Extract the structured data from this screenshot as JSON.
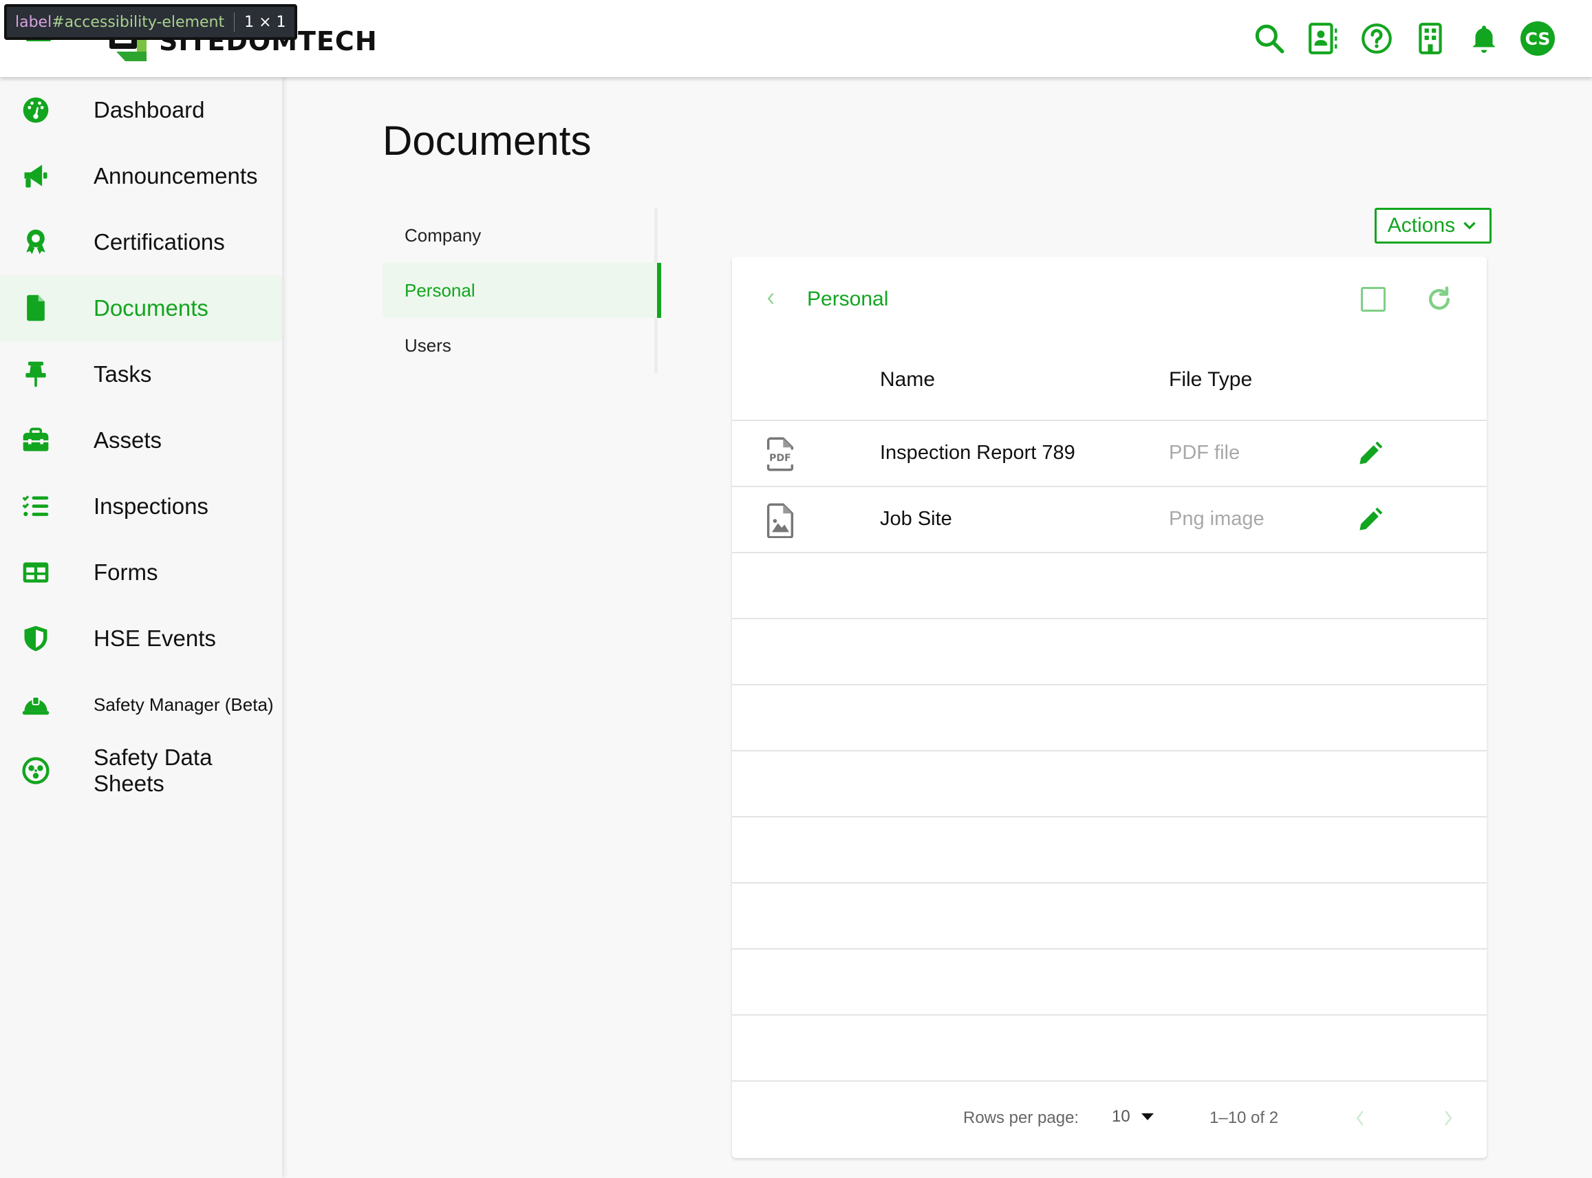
{
  "app": {
    "brand": "SITEDOMTECH",
    "accent_color": "#12a51f",
    "devtools_tooltip": {
      "selector_tag": "label",
      "selector_id": "#accessibility-element",
      "size": "1 × 1"
    }
  },
  "header": {
    "icons": [
      {
        "name": "search-icon",
        "label": "Search"
      },
      {
        "name": "contacts-icon",
        "label": "Contacts"
      },
      {
        "name": "help-icon",
        "label": "Help"
      },
      {
        "name": "company-icon",
        "label": "Company"
      },
      {
        "name": "notifications-icon",
        "label": "Notifications"
      }
    ],
    "avatar_initials": "CS"
  },
  "sidebar": {
    "items": [
      {
        "label": "Dashboard",
        "icon": "dashboard-icon",
        "active": false
      },
      {
        "label": "Announcements",
        "icon": "megaphone-icon",
        "active": false
      },
      {
        "label": "Certifications",
        "icon": "award-icon",
        "active": false
      },
      {
        "label": "Documents",
        "icon": "document-icon",
        "active": true
      },
      {
        "label": "Tasks",
        "icon": "pushpin-icon",
        "active": false
      },
      {
        "label": "Assets",
        "icon": "toolbox-icon",
        "active": false
      },
      {
        "label": "Inspections",
        "icon": "checklist-icon",
        "active": false
      },
      {
        "label": "Forms",
        "icon": "table-icon",
        "active": false
      },
      {
        "label": "HSE Events",
        "icon": "shield-icon",
        "active": false
      },
      {
        "label": "Safety Manager (Beta)",
        "icon": "hardhat-icon",
        "active": false
      },
      {
        "label": "Safety Data Sheets",
        "icon": "hazard-icon",
        "active": false
      }
    ]
  },
  "main": {
    "title": "Documents",
    "subnav": [
      {
        "label": "Company",
        "active": false
      },
      {
        "label": "Personal",
        "active": true
      },
      {
        "label": "Users",
        "active": false
      }
    ],
    "actions_label": "Actions",
    "card": {
      "folder_title": "Personal",
      "columns": [
        "Name",
        "File Type"
      ],
      "rows": [
        {
          "name": "Inspection Report 789",
          "type": "PDF file",
          "icon": "pdf-file-icon"
        },
        {
          "name": "Job Site",
          "type": "Png image",
          "icon": "image-file-icon"
        }
      ],
      "empty_rows": 8,
      "pagination": {
        "rows_per_page_label": "Rows per page:",
        "rows_per_page": "10",
        "range": "1–10 of 2"
      }
    }
  }
}
